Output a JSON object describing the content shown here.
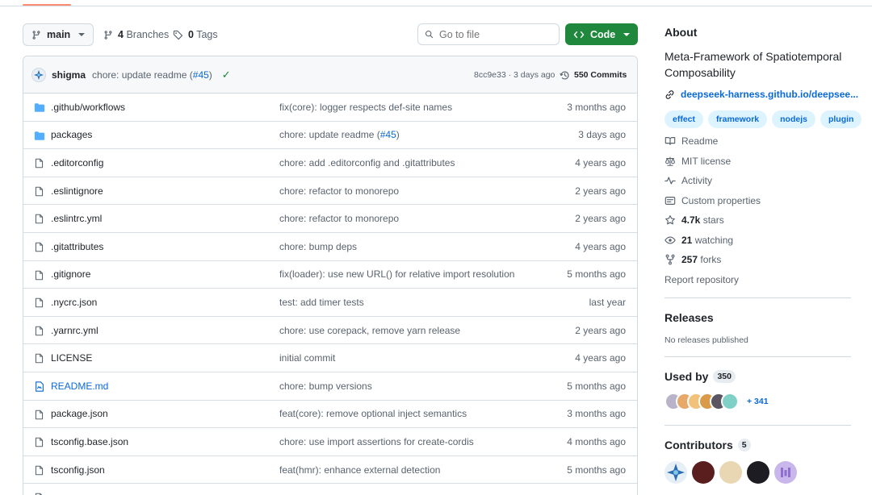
{
  "toolbar": {
    "branch": "main",
    "branches_count": "4",
    "branches_label": "Branches",
    "tags_count": "0",
    "tags_label": "Tags",
    "goto_placeholder": "Go to file",
    "code_label": "Code"
  },
  "last_commit": {
    "author": "shigma",
    "message": "chore: update readme (",
    "pr": "#45",
    "message_end": ")",
    "meta": "8cc9e33 · 3 days ago",
    "commits": "550 Commits"
  },
  "files": [
    {
      "name": ".github/workflows",
      "type": "folder",
      "message": "fix(core): logger respects def-site names",
      "date": "3 months ago"
    },
    {
      "name": "packages",
      "type": "folder",
      "message": "chore: update readme (",
      "pr": "#45",
      "message_end": ")",
      "date": "3 days ago"
    },
    {
      "name": ".editorconfig",
      "type": "file",
      "message": "chore: add .editorconfig and .gitattributes",
      "date": "4 years ago"
    },
    {
      "name": ".eslintignore",
      "type": "file",
      "message": "chore: refactor to monorepo",
      "date": "2 years ago"
    },
    {
      "name": ".eslintrc.yml",
      "type": "file",
      "message": "chore: refactor to monorepo",
      "date": "2 years ago"
    },
    {
      "name": ".gitattributes",
      "type": "file",
      "message": "chore: bump deps",
      "date": "4 years ago"
    },
    {
      "name": ".gitignore",
      "type": "file",
      "message": "fix(loader): use new URL() for relative import resolution",
      "date": "5 months ago"
    },
    {
      "name": ".nycrc.json",
      "type": "file",
      "message": "test: add timer tests",
      "date": "last year"
    },
    {
      "name": ".yarnrc.yml",
      "type": "file",
      "message": "chore: use corepack, remove yarn release",
      "date": "2 years ago"
    },
    {
      "name": "LICENSE",
      "type": "file",
      "message": "initial commit",
      "date": "4 years ago"
    },
    {
      "name": "README.md",
      "type": "readme",
      "message": "chore: bump versions",
      "date": "5 months ago"
    },
    {
      "name": "package.json",
      "type": "file",
      "message": "feat(core): remove optional inject semantics",
      "date": "3 months ago"
    },
    {
      "name": "tsconfig.base.json",
      "type": "file",
      "message": "chore: use import assertions for create-cordis",
      "date": "4 months ago"
    },
    {
      "name": "tsconfig.json",
      "type": "file",
      "message": "feat(hmr): enhance external detection",
      "date": "5 months ago"
    }
  ],
  "about": {
    "title": "About",
    "description": "Meta-Framework of Spatiotemporal Composability",
    "homepage": "deepseek-harness.github.io/deepsee...",
    "topics": [
      "effect",
      "framework",
      "nodejs",
      "plugin"
    ],
    "readme": "Readme",
    "license": "MIT license",
    "activity": "Activity",
    "custom_properties": "Custom properties",
    "stars_count": "4.7k",
    "stars_label": "stars",
    "watching_count": "21",
    "watching_label": "watching",
    "forks_count": "257",
    "forks_label": "forks",
    "report": "Report repository"
  },
  "releases": {
    "title": "Releases",
    "note": "No releases published"
  },
  "used_by": {
    "title": "Used by",
    "count": "350",
    "more": "+ 341"
  },
  "contributors": {
    "title": "Contributors",
    "count": "5"
  },
  "colors": {
    "accent": "#0969da",
    "green": "#1f883d",
    "muted": "#59636e",
    "border": "#d1d9e0"
  }
}
